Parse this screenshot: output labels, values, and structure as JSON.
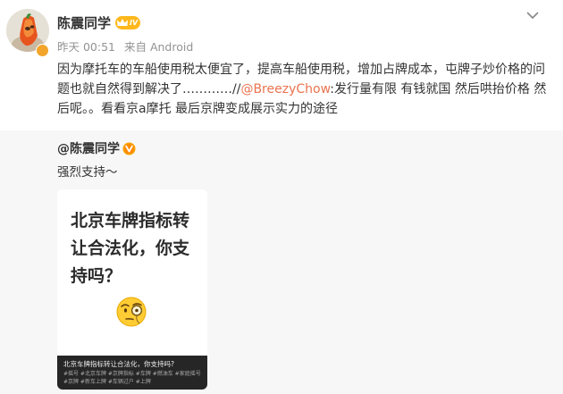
{
  "post": {
    "author": "陈震同学",
    "vip_level": "IV",
    "time": "昨天 00:51",
    "source": "来自 Android",
    "text_before": "因为摩托车的车船使用税太便宜了，提高车船使用税，增加占牌成本，屯牌子炒价格的问题也就自然得到解决了…………//",
    "mention": "@BreezyChow",
    "text_after": ":发行量有限 有钱就国 然后哄抬价格  然后呢。。看看京a摩托 最后京牌变成展示实力的途径"
  },
  "repost": {
    "author": "@陈震同学",
    "text": "强烈支持～",
    "card": {
      "title": "北京车牌指标转让合法化，你支持吗？",
      "footer_title": "北京车牌指标转让合法化，你支持吗?",
      "footer_tags": "#摇号 #北京车牌 #京牌指标 #车牌 #燃油车 #家庭摇号 #京牌 #新车上牌 #车辆过户 #上牌"
    }
  },
  "colors": {
    "mention": "#eb7350",
    "vip_badge": "#ffb81c",
    "repost_bg": "#f7f7f7",
    "meta_text": "#939393"
  },
  "icons": {
    "menu": "chevron-down-icon",
    "verified": "gold-v-icon",
    "card_emoji": "monocle-face-icon"
  }
}
